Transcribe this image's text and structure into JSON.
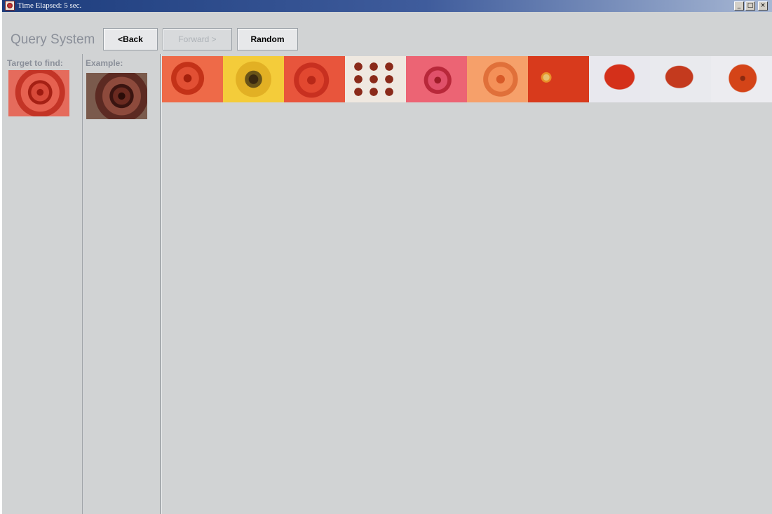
{
  "window": {
    "title": "Time Elapsed: 5 sec.",
    "controls": {
      "minimize": "_",
      "maximize": "□",
      "close": "×"
    }
  },
  "toolbar": {
    "app_title": "Query System",
    "back_label": "<Back",
    "forward_label": "Forward >",
    "random_label": "Random"
  },
  "target_panel": {
    "label": "Target to find:",
    "image": "red-rose"
  },
  "example_panel": {
    "label": "Example:",
    "image": "dark-rose"
  },
  "results": [
    {
      "image": "red-rose-closeup"
    },
    {
      "image": "sunflower"
    },
    {
      "image": "red-rose-soft"
    },
    {
      "image": "rose-bouquet-grid"
    },
    {
      "image": "pink-red-rose"
    },
    {
      "image": "orange-rose"
    },
    {
      "image": "red-gerbera"
    },
    {
      "image": "red-rose-white-bg"
    },
    {
      "image": "red-rose-bud-white-bg"
    },
    {
      "image": "red-daisy-white-bg"
    }
  ],
  "colors": {
    "titlebar_start": "#1c3c7c",
    "panel_bg": "#d1d3d4",
    "label_text": "#8a8f99"
  }
}
